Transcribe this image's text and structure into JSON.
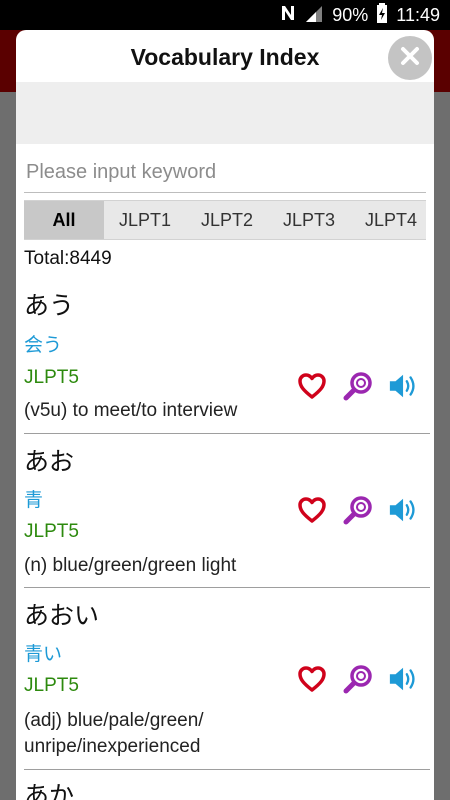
{
  "status_bar": {
    "battery": "90%",
    "time": "11:49"
  },
  "dialog": {
    "title": "Vocabulary Index",
    "search": {
      "placeholder": "Please input keyword",
      "value": ""
    },
    "tabs": [
      {
        "label": "All",
        "selected": true
      },
      {
        "label": "JLPT1"
      },
      {
        "label": "JLPT2"
      },
      {
        "label": "JLPT3"
      },
      {
        "label": "JLPT4"
      }
    ],
    "total": "Total:8449",
    "entries": [
      {
        "kana": "あう",
        "kanji": "会う",
        "level": "JLPT5",
        "meaning": "(v5u) to meet/to interview"
      },
      {
        "kana": "あお",
        "kanji": "青",
        "level": "JLPT5",
        "meaning": "(n) blue/green/green light"
      },
      {
        "kana": "あおい",
        "kanji": "青い",
        "level": "JLPT5",
        "meaning": "(adj) blue/pale/green/ unripe/inexperienced"
      },
      {
        "kana": "あか",
        "kanji": "",
        "level": "",
        "meaning": ""
      }
    ]
  },
  "colors": {
    "heart": "#d0021b",
    "search": "#9b27b0",
    "speaker": "#1e9ad6",
    "level": "#2d8a0e",
    "kanji": "#1e9ad6"
  },
  "icons": [
    "favorite-heart-icon",
    "search-magnifier-icon",
    "speaker-audio-icon",
    "close-icon",
    "nfc-icon",
    "signal-icon",
    "battery-icon"
  ]
}
